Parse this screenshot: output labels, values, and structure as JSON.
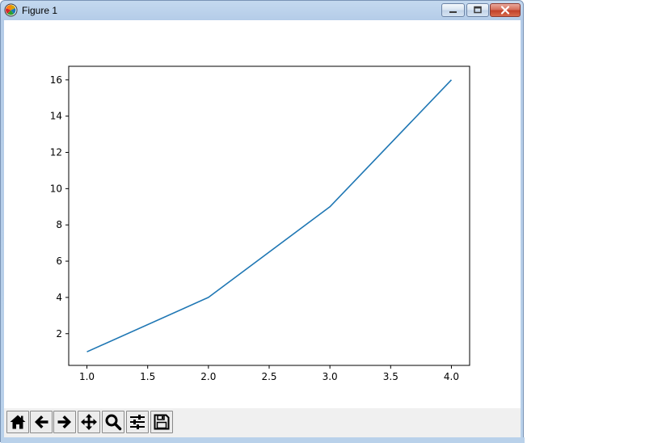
{
  "window": {
    "title": "Figure 1",
    "controls": {
      "minimize_icon": "minimize-icon",
      "maximize_icon": "maximize-icon",
      "close_icon": "close-icon"
    }
  },
  "toolbar": {
    "buttons": [
      {
        "name": "home-button",
        "icon": "home-icon"
      },
      {
        "name": "back-button",
        "icon": "arrow-left-icon"
      },
      {
        "name": "forward-button",
        "icon": "arrow-right-icon"
      },
      {
        "name": "pan-button",
        "icon": "move-icon"
      },
      {
        "name": "zoom-button",
        "icon": "magnifier-icon"
      },
      {
        "name": "configure-subplots-button",
        "icon": "sliders-icon"
      },
      {
        "name": "save-button",
        "icon": "floppy-disk-icon"
      }
    ]
  },
  "chart_data": {
    "type": "line",
    "x": [
      1.0,
      2.0,
      3.0,
      4.0
    ],
    "series": [
      {
        "values": [
          1,
          4,
          9,
          16
        ],
        "color": "#1f77b4"
      }
    ],
    "xlim": [
      0.85,
      4.15
    ],
    "ylim": [
      0.25,
      16.75
    ],
    "xticks": [
      "1.0",
      "1.5",
      "2.0",
      "2.5",
      "3.0",
      "3.5",
      "4.0"
    ],
    "xtick_values": [
      1.0,
      1.5,
      2.0,
      2.5,
      3.0,
      3.5,
      4.0
    ],
    "yticks": [
      "2",
      "4",
      "6",
      "8",
      "10",
      "12",
      "14",
      "16"
    ],
    "ytick_values": [
      2,
      4,
      6,
      8,
      10,
      12,
      14,
      16
    ],
    "grid": false,
    "title": "",
    "xlabel": "",
    "ylabel": ""
  }
}
